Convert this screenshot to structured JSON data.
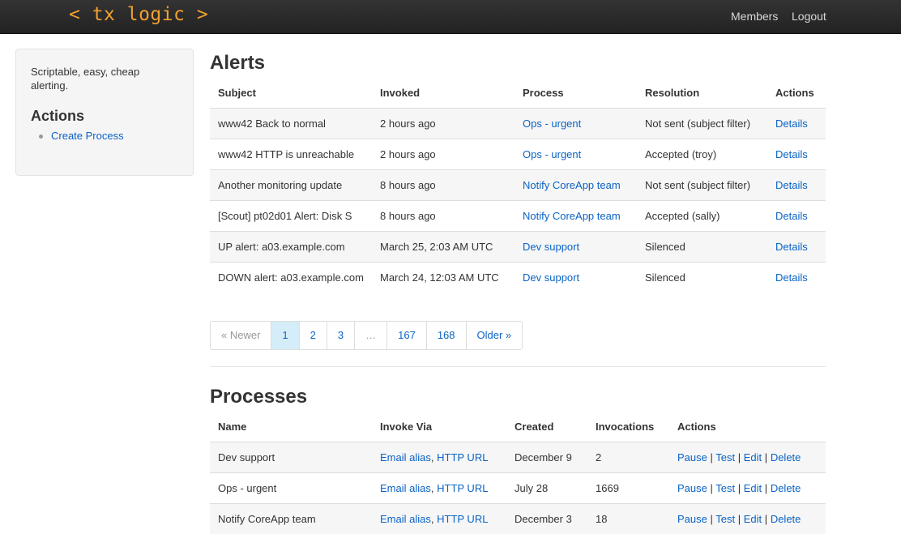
{
  "nav": {
    "brand": "< tx logic >",
    "members": "Members",
    "logout": "Logout"
  },
  "sidebar": {
    "tagline": "Scriptable, easy, cheap alerting.",
    "heading": "Actions",
    "create_process": "Create Process"
  },
  "alerts": {
    "title": "Alerts",
    "headers": [
      "Subject",
      "Invoked",
      "Process",
      "Resolution",
      "Actions"
    ],
    "rows": [
      {
        "subject": "www42 Back to normal",
        "invoked": "2 hours ago",
        "process": "Ops - urgent",
        "resolution": "Not sent (subject filter)",
        "action": "Details"
      },
      {
        "subject": "www42 HTTP is unreachable",
        "invoked": "2 hours ago",
        "process": "Ops - urgent",
        "resolution": "Accepted (troy)",
        "action": "Details"
      },
      {
        "subject": "Another monitoring update",
        "invoked": "8 hours ago",
        "process": "Notify CoreApp team",
        "resolution": "Not sent (subject filter)",
        "action": "Details"
      },
      {
        "subject": "[Scout] pt02d01 Alert: Disk S",
        "invoked": "8 hours ago",
        "process": "Notify CoreApp team",
        "resolution": "Accepted (sally)",
        "action": "Details"
      },
      {
        "subject": "UP alert: a03.example.com",
        "invoked": "March 25, 2:03 AM UTC",
        "process": "Dev support",
        "resolution": "Silenced",
        "action": "Details"
      },
      {
        "subject": "DOWN alert: a03.example.com",
        "invoked": "March 24, 12:03 AM UTC",
        "process": "Dev support",
        "resolution": "Silenced",
        "action": "Details"
      }
    ]
  },
  "pagination": {
    "newer": "« Newer",
    "pages": [
      "1",
      "2",
      "3",
      "…",
      "167",
      "168"
    ],
    "older": "Older »",
    "current": "1"
  },
  "processes": {
    "title": "Processes",
    "headers": [
      "Name",
      "Invoke Via",
      "Created",
      "Invocations",
      "Actions"
    ],
    "rows": [
      {
        "name": "Dev support",
        "email": "Email alias",
        "http": "HTTP URL",
        "created": "December 9",
        "invocations": "2"
      },
      {
        "name": "Ops - urgent",
        "email": "Email alias",
        "http": "HTTP URL",
        "created": "July 28",
        "invocations": "1669"
      },
      {
        "name": "Notify CoreApp team",
        "email": "Email alias",
        "http": "HTTP URL",
        "created": "December 3",
        "invocations": "18"
      }
    ],
    "actions": {
      "pause": "Pause",
      "test": "Test",
      "edit": "Edit",
      "delete": "Delete",
      "separator": "|",
      "comma": ","
    }
  }
}
